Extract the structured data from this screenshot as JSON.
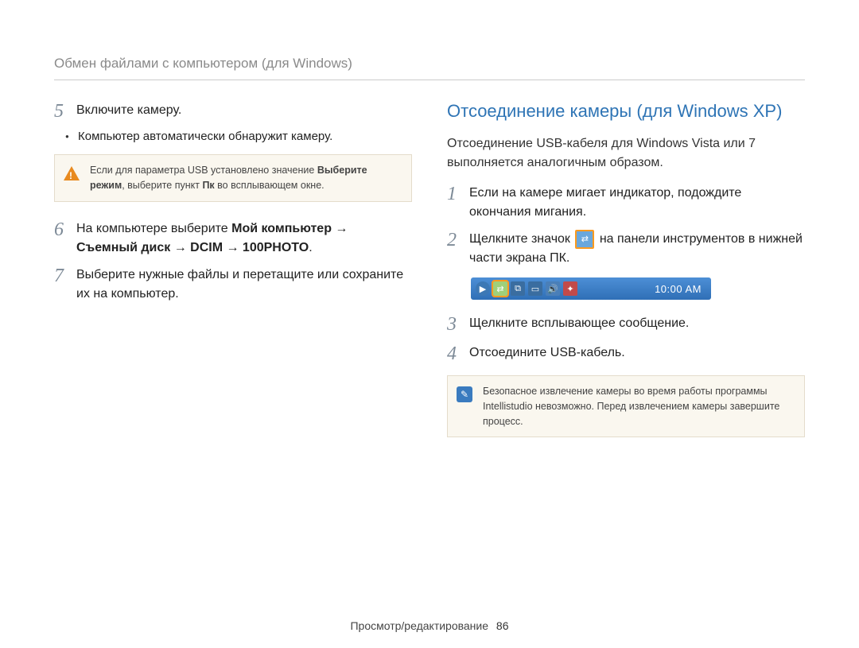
{
  "header": {
    "title": "Обмен файлами с компьютером (для Windows)"
  },
  "left": {
    "step5": {
      "num": "5",
      "text": "Включите камеру.",
      "bullet": "Компьютер автоматически обнаружит камеру."
    },
    "warning": {
      "part1": "Если для параметра USB установлено значение ",
      "bold1": "Выберите режим",
      "part2": ", выберите пункт ",
      "bold2": "Пк",
      "part3": " во всплывающем окне."
    },
    "step6": {
      "num": "6",
      "pre": "На компьютере выберите ",
      "b1": "Мой компьютер",
      "arr": " → ",
      "b2": "Съемный диск",
      "b3": "DCIM",
      "b4": "100PHOTO",
      "dot": "."
    },
    "step7": {
      "num": "7",
      "text": "Выберите нужные файлы и перетащите или сохраните их на компьютер."
    }
  },
  "right": {
    "title": "Отсоединение камеры (для Windows XP)",
    "intro": "Отсоединение USB-кабеля для Windows Vista или 7 выполняется аналогичным образом.",
    "step1": {
      "num": "1",
      "text": "Если на камере мигает индикатор, подождите окончания мигания."
    },
    "step2": {
      "num": "2",
      "pre": "Щелкните значок ",
      "post": " на панели инструментов в нижней части экрана ПК."
    },
    "taskbar": {
      "clock": "10:00 AM"
    },
    "step3": {
      "num": "3",
      "text": "Щелкните всплывающее сообщение."
    },
    "step4": {
      "num": "4",
      "text": "Отсоедините USB-кабель."
    },
    "info": "Безопасное извлечение камеры во время работы программы Intellistudio невозможно. Перед извлечением камеры завершите процесс."
  },
  "footer": {
    "section": "Просмотр/редактирование",
    "page": "86"
  },
  "icons": {
    "warning": "warning-triangle-icon",
    "info": "info-square-icon",
    "safe_remove": "safe-remove-hardware-icon"
  }
}
